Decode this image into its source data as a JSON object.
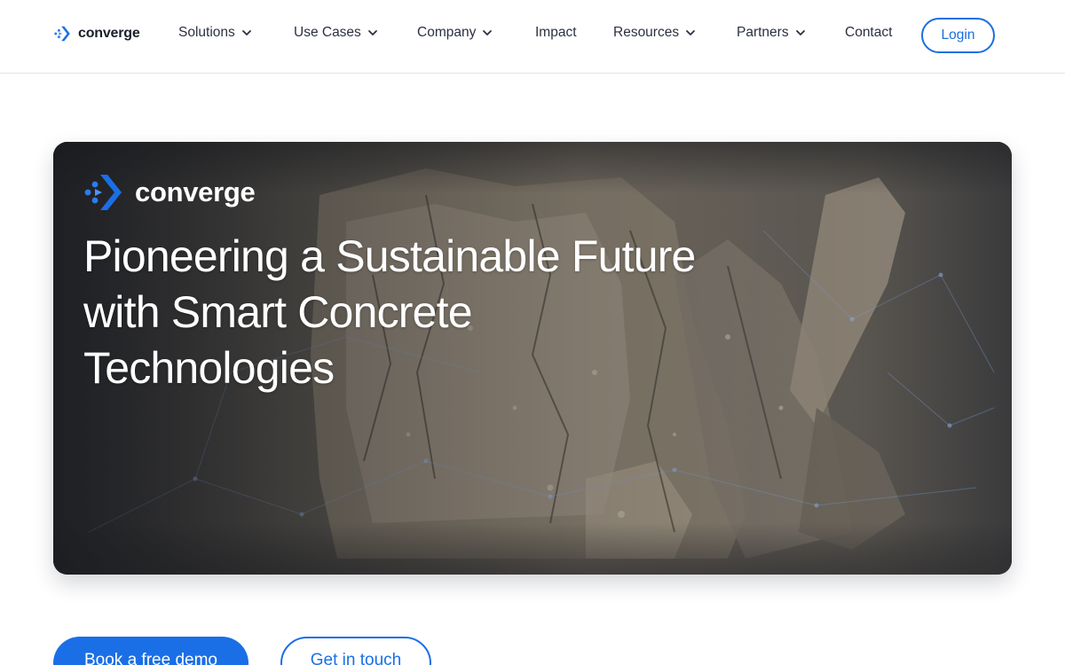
{
  "brand": {
    "name": "converge",
    "logo_icon": "converge-arrow-logo",
    "primary_color": "#1a6fe6",
    "accent_color": "#2b7cf0"
  },
  "nav": {
    "items": [
      {
        "label": "Solutions",
        "has_dropdown": true
      },
      {
        "label": "Use Cases",
        "has_dropdown": true
      },
      {
        "label": "Company",
        "has_dropdown": true
      },
      {
        "label": "Impact",
        "has_dropdown": false
      },
      {
        "label": "Resources",
        "has_dropdown": true
      },
      {
        "label": "Partners",
        "has_dropdown": true
      },
      {
        "label": "Contact",
        "has_dropdown": false
      }
    ],
    "login_label": "Login",
    "dropdown_icon": "chevron-down-icon"
  },
  "hero": {
    "logo_text": "converge",
    "title_lines": [
      "Pioneering a Sustainable Future",
      "with Smart Concrete",
      "Technologies"
    ],
    "background": "crumbling-concrete-sample-photo"
  },
  "cta": {
    "primary_label": "Book a free demo",
    "secondary_label": "Get in touch"
  }
}
